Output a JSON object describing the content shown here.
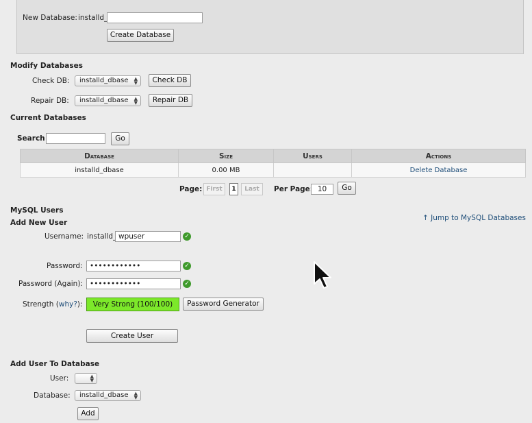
{
  "create_db": {
    "label": "New Database:",
    "prefix": "installd_",
    "value": "",
    "button": "Create Database"
  },
  "modify": {
    "heading": "Modify Databases",
    "check_label": "Check DB:",
    "check_selected": "installd_dbase",
    "check_button": "Check DB",
    "repair_label": "Repair DB:",
    "repair_selected": "installd_dbase",
    "repair_button": "Repair DB"
  },
  "current": {
    "heading": "Current Databases",
    "search_label": "Search",
    "search_value": "",
    "go": "Go",
    "columns": [
      "Database",
      "Size",
      "Users",
      "Actions"
    ],
    "rows": [
      {
        "database": "installd_dbase",
        "size": "0.00 MB",
        "users": "",
        "action": "Delete Database"
      }
    ],
    "pagination": {
      "page_label": "Page:",
      "first": "First",
      "current": "1",
      "last": "Last",
      "per_page_label": "Per Page:",
      "per_page_value": "10",
      "go": "Go"
    }
  },
  "users": {
    "heading": "MySQL Users",
    "subheading": "Add New User",
    "jump_link": "Jump to MySQL Databases",
    "username_label": "Username:",
    "username_prefix": "installd_",
    "username_value": "wpuser",
    "password_label": "Password:",
    "password_value": "••••••••••••",
    "password_again_label": "Password (Again):",
    "password_again_value": "••••••••••••",
    "strength_label": "Strength (",
    "strength_why": "why?",
    "strength_suffix": "):",
    "strength_value": "Very Strong (100/100)",
    "strength_color": "#7ce82a",
    "generator_button": "Password Generator",
    "create_button": "Create User"
  },
  "add_to_db": {
    "heading": "Add User To Database",
    "user_label": "User:",
    "user_selected": "",
    "database_label": "Database:",
    "database_selected": "installd_dbase",
    "add_button": "Add"
  }
}
